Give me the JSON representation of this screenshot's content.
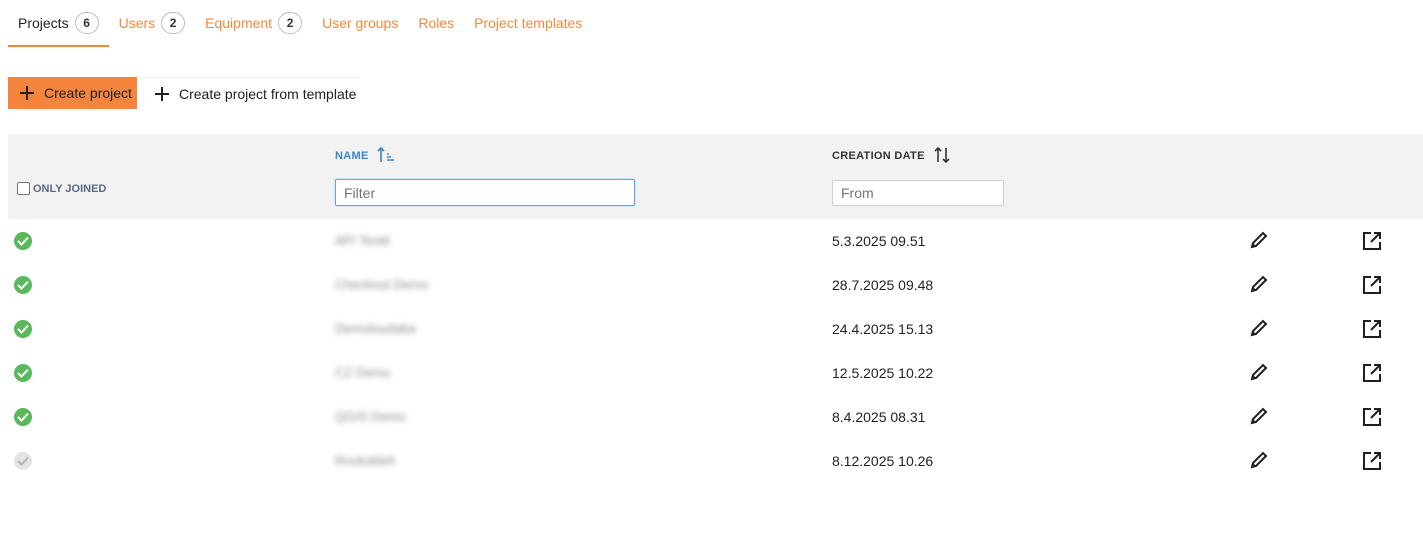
{
  "tabs": [
    {
      "label": "Projects",
      "count": "6"
    },
    {
      "label": "Users",
      "count": "2"
    },
    {
      "label": "Equipment",
      "count": "2"
    },
    {
      "label": "User groups"
    },
    {
      "label": "Roles"
    },
    {
      "label": "Project templates"
    }
  ],
  "actions": {
    "create_label": "Create project",
    "create_template_label": "Create project from template"
  },
  "table": {
    "only_joined_label": "ONLY JOINED",
    "name_header": "NAME",
    "date_header": "CREATION DATE",
    "name_filter_placeholder": "Filter",
    "date_filter_placeholder": "From",
    "rows": [
      {
        "name": "API Testit",
        "date": "5.3.2025 09.51",
        "status": "joined"
      },
      {
        "name": "Checkout Demo",
        "date": "28.7.2025 09.48",
        "status": "joined"
      },
      {
        "name": "Demoloudaba",
        "date": "24.4.2025 15.13",
        "status": "joined"
      },
      {
        "name": "CZ Demo",
        "date": "12.5.2025 10.22",
        "status": "joined"
      },
      {
        "name": "QGIS Demo",
        "date": "8.4.2025 08.31",
        "status": "joined"
      },
      {
        "name": "Rooksklelt",
        "date": "8.12.2025 10.26",
        "status": "not-joined"
      }
    ]
  },
  "colors": {
    "accent": "#f5853d",
    "link": "#3a86c8",
    "joined": "#5cb85c",
    "not_joined": "#e4e4e4"
  },
  "icons": {
    "edit": "pencil-icon",
    "open": "external-link-icon",
    "status": "check-circle-icon",
    "sort_name": "sort-ascending-icon",
    "sort_date": "sort-both-icon"
  }
}
